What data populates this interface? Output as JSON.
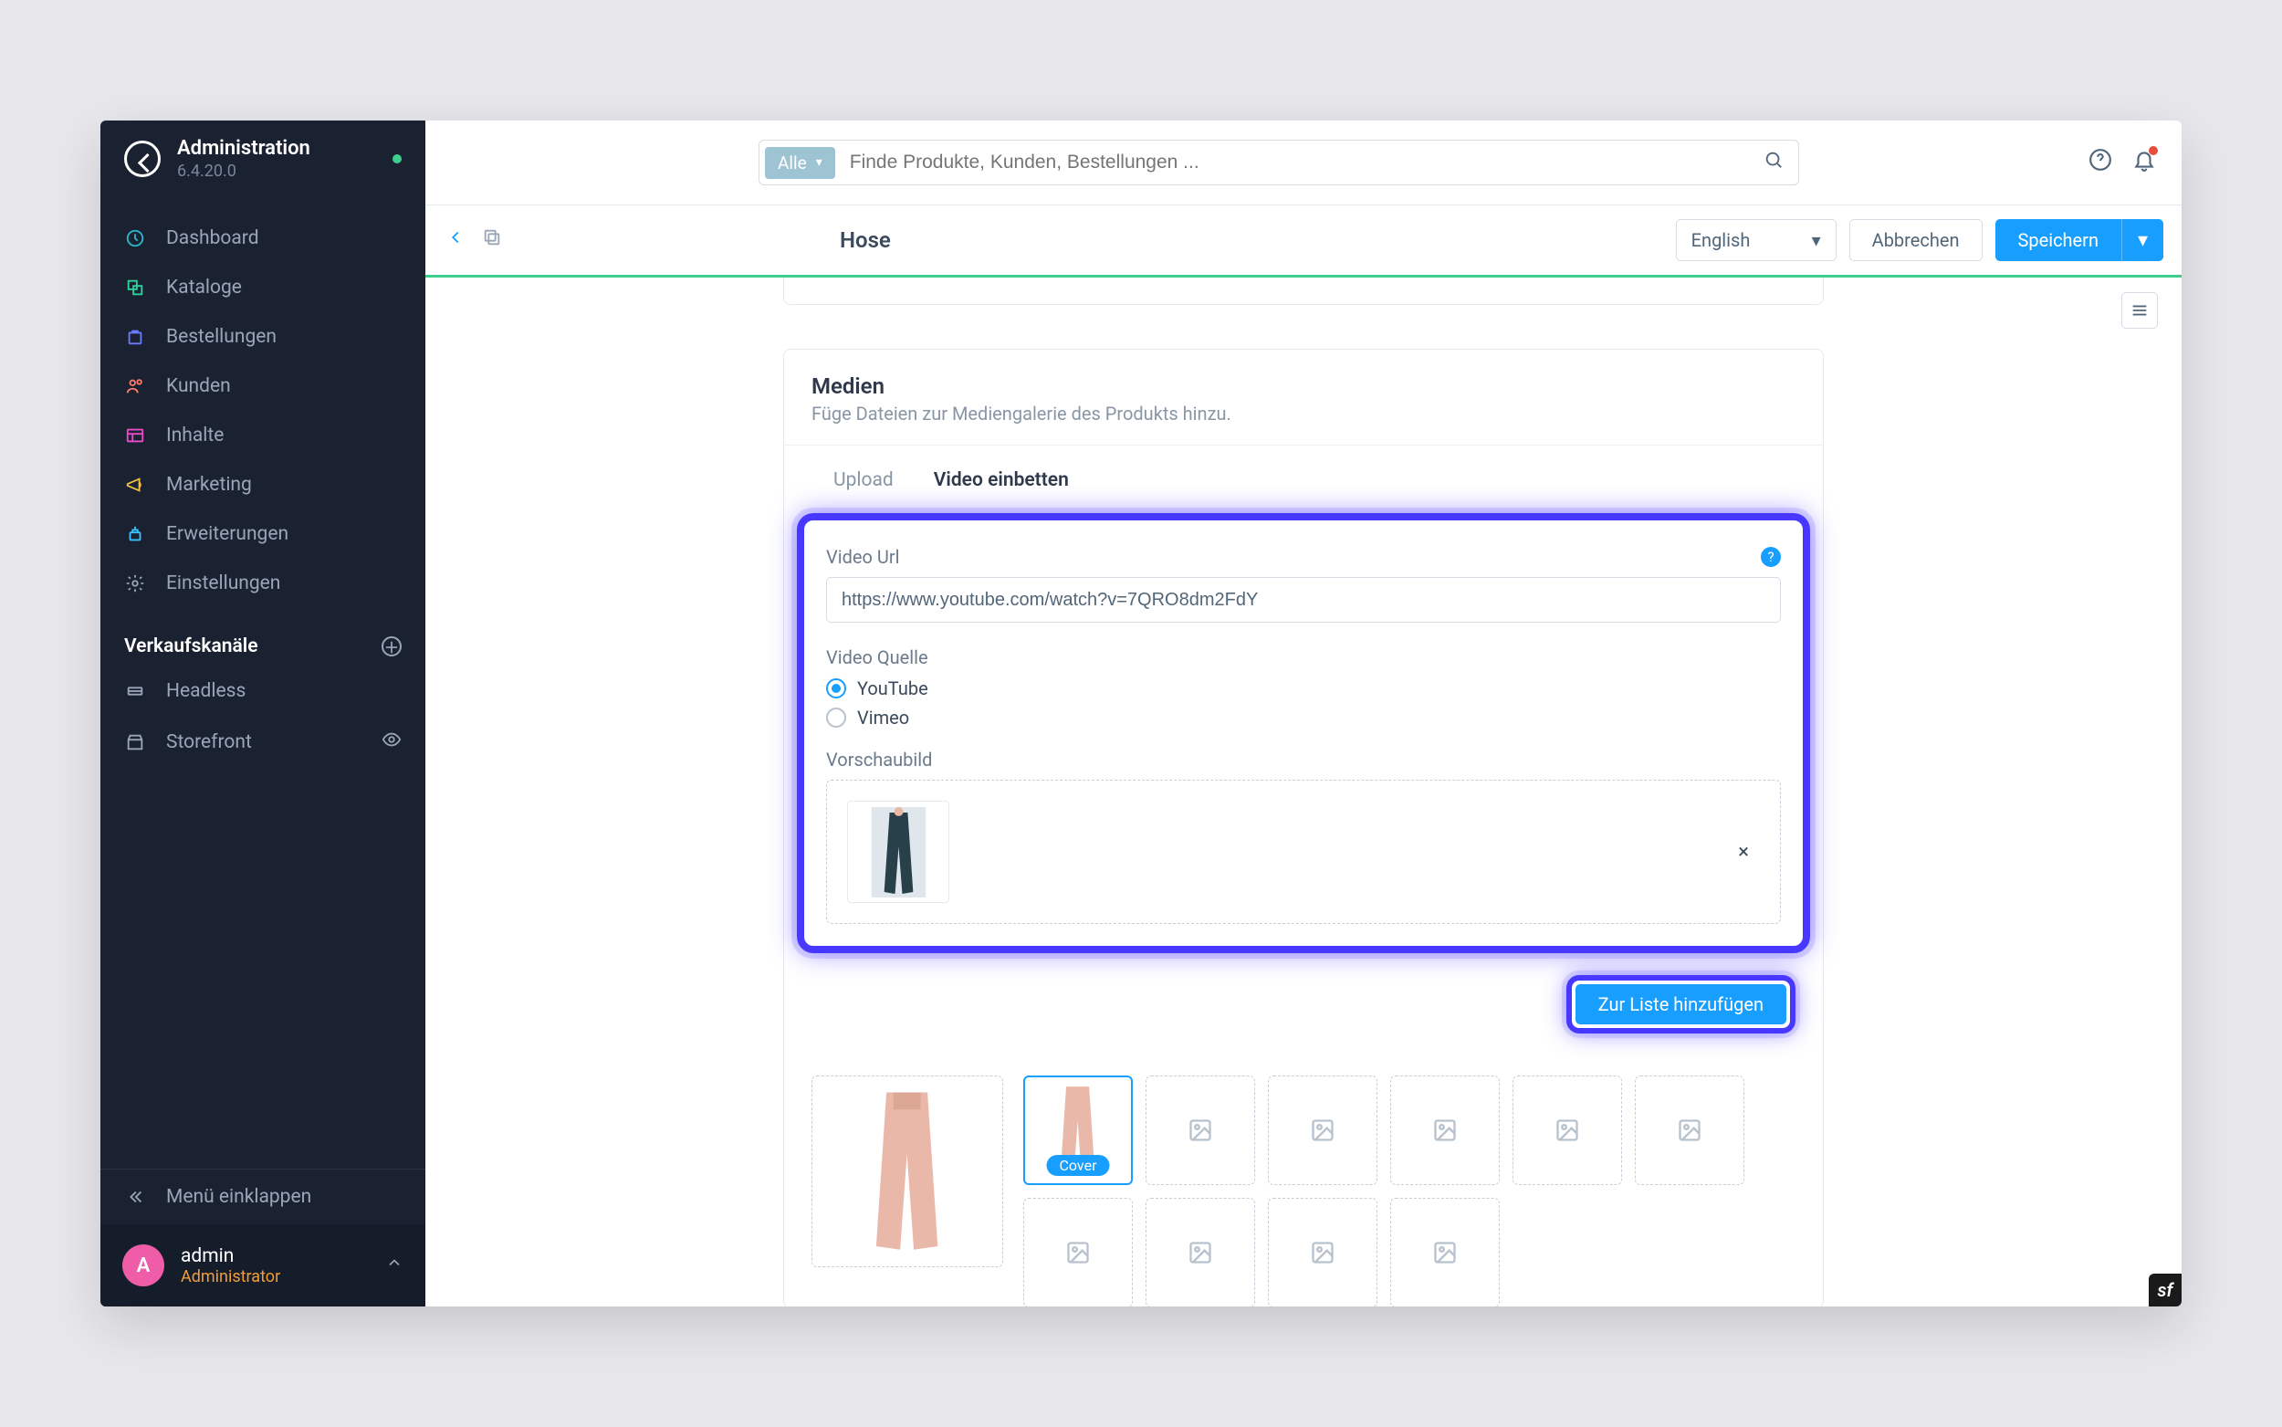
{
  "sidebar": {
    "title": "Administration",
    "version": "6.4.20.0",
    "items": [
      {
        "label": "Dashboard",
        "name": "sidebar-item-dashboard"
      },
      {
        "label": "Kataloge",
        "name": "sidebar-item-catalogs"
      },
      {
        "label": "Bestellungen",
        "name": "sidebar-item-orders"
      },
      {
        "label": "Kunden",
        "name": "sidebar-item-customers"
      },
      {
        "label": "Inhalte",
        "name": "sidebar-item-content"
      },
      {
        "label": "Marketing",
        "name": "sidebar-item-marketing"
      },
      {
        "label": "Erweiterungen",
        "name": "sidebar-item-extensions"
      },
      {
        "label": "Einstellungen",
        "name": "sidebar-item-settings"
      }
    ],
    "channels_title": "Verkaufskanäle",
    "channels": [
      {
        "label": "Headless",
        "name": "sidebar-channel-headless"
      },
      {
        "label": "Storefront",
        "name": "sidebar-channel-storefront"
      }
    ],
    "collapse_label": "Menü einklappen",
    "user_name": "admin",
    "user_role": "Administrator",
    "user_initial": "A"
  },
  "search": {
    "filter_label": "Alle",
    "placeholder": "Finde Produkte, Kunden, Bestellungen ..."
  },
  "actionbar": {
    "title": "Hose",
    "language": "English",
    "cancel": "Abbrechen",
    "save": "Speichern"
  },
  "card": {
    "title": "Medien",
    "subtitle": "Füge Dateien zur Mediengalerie des Produkts hinzu.",
    "tab_upload": "Upload",
    "tab_embed": "Video einbetten",
    "video_url_label": "Video Url",
    "video_url_value": "https://www.youtube.com/watch?v=7QRO8dm2FdY",
    "video_source_label": "Video Quelle",
    "source_youtube": "YouTube",
    "source_vimeo": "Vimeo",
    "thumb_label": "Vorschaubild",
    "add_button": "Zur Liste hinzufügen",
    "cover_label": "Cover"
  },
  "icon_colors": {
    "dashboard": "#2bb5c9",
    "catalogs": "#2fd39c",
    "orders": "#6a7bff",
    "customers": "#ff7b6b",
    "content": "#ec4bc8",
    "marketing": "#f5c042",
    "extensions": "#37c3ff",
    "settings": "#9aa6b8",
    "channel": "#9aa6b8"
  }
}
